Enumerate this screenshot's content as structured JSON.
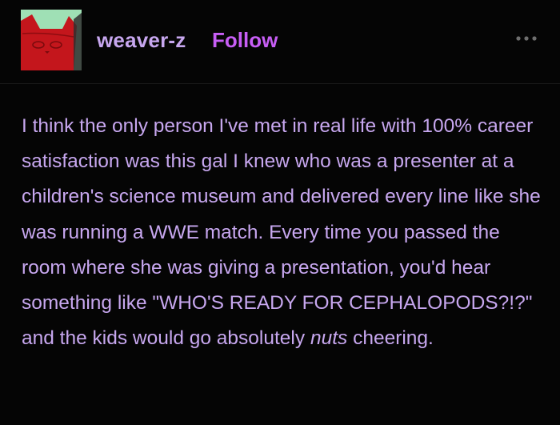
{
  "post": {
    "username": "weaver-z",
    "follow_label": "Follow",
    "more_icon": "more-horizontal-icon",
    "avatar_icon": "red-cat-avatar",
    "body_before_em": "I think the only person I've met in real life with 100% career satisfaction was this gal I knew who was a presenter at a children's science museum and delivered every line like she was running a WWE match. Every time you passed the room where she was giving a presentation, you'd hear something like \"WHO'S READY FOR CEPHALOPODS?!?\" and the kids would go absolutely",
    "body_em": "nuts",
    "body_after_em": " cheering."
  },
  "colors": {
    "background": "#050505",
    "text": "#c7a7ef",
    "follow": "#c75ef5",
    "avatar_bg": "#9fe0b5",
    "avatar_cat": "#c4161c"
  }
}
